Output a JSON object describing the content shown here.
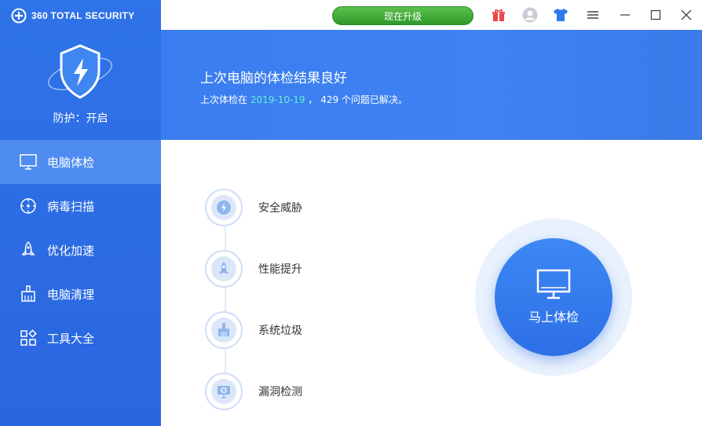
{
  "app": {
    "brand": "360 TOTAL SECURITY"
  },
  "sidebar": {
    "protect_status": "防护：开启",
    "items": [
      {
        "label": "电脑体检",
        "icon": "monitor-icon",
        "active": true
      },
      {
        "label": "病毒扫描",
        "icon": "virus-scan-icon",
        "active": false
      },
      {
        "label": "优化加速",
        "icon": "rocket-icon",
        "active": false
      },
      {
        "label": "电脑清理",
        "icon": "broom-icon",
        "active": false
      },
      {
        "label": "工具大全",
        "icon": "toolbox-icon",
        "active": false
      }
    ]
  },
  "titlebar": {
    "upgrade_label": "现在升级",
    "icons": [
      "gift-icon",
      "avatar-icon",
      "skin-shirt-icon",
      "menu-icon",
      "minimize-icon",
      "maximize-icon",
      "close-icon"
    ]
  },
  "banner": {
    "title": "上次电脑的体检结果良好",
    "sub_prefix": "上次体检在 ",
    "sub_date": "2019-10-19",
    "sub_suffix": " ， 429 个问题已解决。"
  },
  "steps": [
    {
      "label": "安全威胁",
      "icon": "security-threat-icon"
    },
    {
      "label": "性能提升",
      "icon": "rocket-icon"
    },
    {
      "label": "系统垃圾",
      "icon": "broom-icon"
    },
    {
      "label": "漏洞检测",
      "icon": "vulnerability-icon"
    }
  ],
  "main": {
    "check_button": "马上体检"
  },
  "colors": {
    "sidebar": "#2f73e8",
    "active_item": "#4f8cf0",
    "banner": "#3a7df0",
    "date_accent": "#64f0d8",
    "upgrade": "#3aa834"
  }
}
